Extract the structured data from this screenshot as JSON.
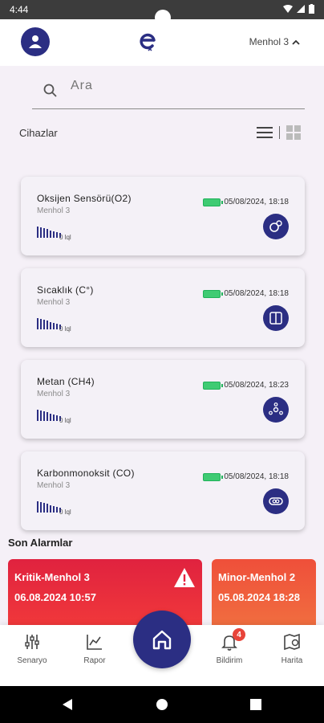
{
  "status_bar": {
    "time": "4:44"
  },
  "header": {
    "location": "Menhol 3",
    "logo_icon": "e-logo",
    "avatar_icon": "person-icon"
  },
  "search": {
    "placeholder": "Ara",
    "value": ""
  },
  "devices_section": {
    "title": "Cihazlar"
  },
  "devices": [
    {
      "name": "Oksijen Sensörü(O2)",
      "location": "Menhol 3",
      "date": "05/08/2024, 18:18",
      "signal": "0 lql",
      "icon": "o2-icon"
    },
    {
      "name": "Sıcaklık (C°)",
      "location": "Menhol 3",
      "date": "05/08/2024, 18:18",
      "signal": "0 lql",
      "icon": "temperature-icon"
    },
    {
      "name": "Metan (CH4)",
      "location": "Menhol 3",
      "date": "05/08/2024, 18:23",
      "signal": "0 lql",
      "icon": "methane-icon"
    },
    {
      "name": "Karbonmonoksit (CO)",
      "location": "Menhol 3",
      "date": "05/08/2024, 18:18",
      "signal": "0 lql",
      "icon": "co-icon"
    }
  ],
  "alarms": {
    "title": "Son Alarmlar",
    "items": [
      {
        "title": "Kritik-Menhol 3",
        "date": "06.08.2024 10:57",
        "level": "critical",
        "color": "#e6223f"
      },
      {
        "title": "Minor-Menhol 2",
        "date": "05.08.2024 18:28",
        "level": "minor",
        "color": "#ef5a3c"
      }
    ]
  },
  "bottom_nav": {
    "items": [
      {
        "label": "Senaryo",
        "icon": "sliders-icon"
      },
      {
        "label": "Rapor",
        "icon": "chart-icon"
      },
      {
        "label": "Bildirim",
        "icon": "bell-icon",
        "badge": "4"
      },
      {
        "label": "Harita",
        "icon": "map-icon"
      }
    ]
  },
  "colors": {
    "primary": "#2b2e83",
    "critical": "#e6223f",
    "minor": "#ef5a3c",
    "battery": "#3fcb73"
  }
}
